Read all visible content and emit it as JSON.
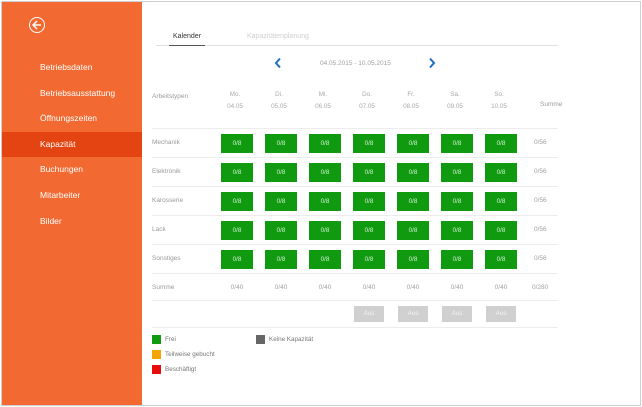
{
  "sidebar": {
    "items": [
      {
        "label": "Betriebsdaten",
        "active": false
      },
      {
        "label": "Betriebsausstattung",
        "active": false
      },
      {
        "label": "Öffnungszeiten",
        "active": false
      },
      {
        "label": "Kapazität",
        "active": true
      },
      {
        "label": "Buchungen",
        "active": false
      },
      {
        "label": "Mitarbeiter",
        "active": false
      },
      {
        "label": "Bilder",
        "active": false
      }
    ],
    "colors": {
      "background": "#f26a31",
      "active": "#e44312"
    }
  },
  "tabs": [
    {
      "label": "Kalender",
      "active": true
    },
    {
      "label": "Kapazitätenplanung",
      "active": false
    }
  ],
  "week": {
    "label": "04.05.2015 - 10.05.2015",
    "prev_icon": "chevron-left-icon",
    "next_icon": "chevron-right-icon"
  },
  "grid": {
    "row_header": "Arbeitstypen",
    "sum_header": "Summe",
    "days": [
      {
        "name": "Mo.",
        "date": "04.05"
      },
      {
        "name": "Di.",
        "date": "05.05"
      },
      {
        "name": "Mi.",
        "date": "06.05"
      },
      {
        "name": "Do.",
        "date": "07.05"
      },
      {
        "name": "Fr.",
        "date": "08.05"
      },
      {
        "name": "Sa.",
        "date": "09.05"
      },
      {
        "name": "So.",
        "date": "10.05"
      }
    ],
    "rows": [
      {
        "label": "Mechanik",
        "cells": [
          "0/8",
          "0/8",
          "0/8",
          "0/8",
          "0/8",
          "0/8",
          "0/8"
        ],
        "sum": "0/56"
      },
      {
        "label": "Elektronik",
        "cells": [
          "0/8",
          "0/8",
          "0/8",
          "0/8",
          "0/8",
          "0/8",
          "0/8"
        ],
        "sum": "0/56"
      },
      {
        "label": "Karosserie",
        "cells": [
          "0/8",
          "0/8",
          "0/8",
          "0/8",
          "0/8",
          "0/8",
          "0/8"
        ],
        "sum": "0/56"
      },
      {
        "label": "Lack",
        "cells": [
          "0/8",
          "0/8",
          "0/8",
          "0/8",
          "0/8",
          "0/8",
          "0/8"
        ],
        "sum": "0/56"
      },
      {
        "label": "Sonstiges",
        "cells": [
          "0/8",
          "0/8",
          "0/8",
          "0/8",
          "0/8",
          "0/8",
          "0/8"
        ],
        "sum": "0/56"
      }
    ],
    "sum_row": {
      "label": "Summe",
      "values": [
        "0/40",
        "0/40",
        "0/40",
        "0/40",
        "0/40",
        "0/40",
        "0/40"
      ],
      "total": "0/280"
    },
    "aus_buttons": [
      "Aus",
      "Aus",
      "Aus",
      "Aus"
    ],
    "cell_color": "#0f9a0f"
  },
  "legend": [
    {
      "label": "Frei",
      "color": "#0f9a0f"
    },
    {
      "label": "Teilweise gebucht",
      "color": "#f5a400"
    },
    {
      "label": "Beschäftigt",
      "color": "#e80c0c"
    },
    {
      "label": "Keine Kapazität",
      "color": "#666666"
    }
  ]
}
